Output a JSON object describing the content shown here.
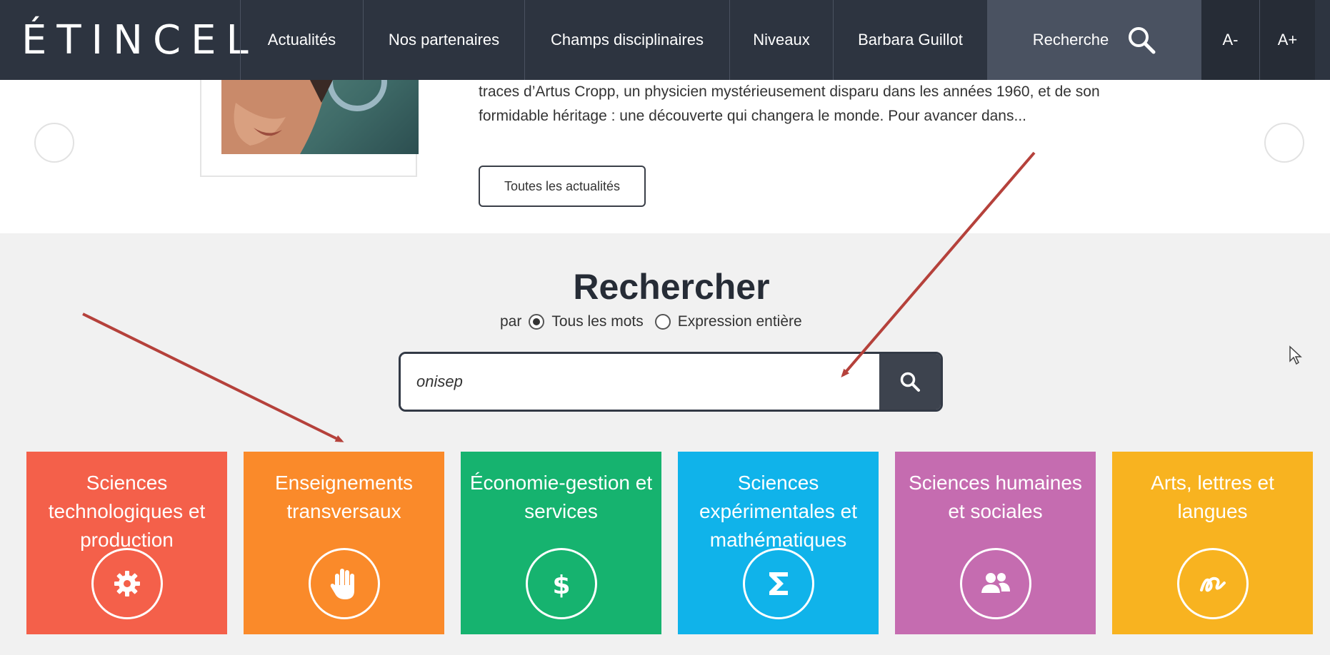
{
  "nav": {
    "logo": "ÉTINCEL",
    "items": [
      {
        "label": "Actualités"
      },
      {
        "label": "Nos partenaires"
      },
      {
        "label": "Champs disciplinaires"
      },
      {
        "label": "Niveaux"
      },
      {
        "label": "Barbara Guillot"
      }
    ],
    "search_label": "Recherche",
    "font_decrease": "A-",
    "font_increase": "A+"
  },
  "news": {
    "excerpt": "traces d’Artus Cropp, un physicien mystérieusement disparu dans les années 1960, et de son formidable héritage : une découverte qui changera le monde. Pour avancer dans...",
    "all_news_button": "Toutes les actualités"
  },
  "search": {
    "title": "Rechercher",
    "by_label": "par",
    "mode_all_words": "Tous les mots",
    "mode_exact": "Expression entière",
    "selected_mode": "Tous les mots",
    "query": "onisep"
  },
  "tiles": [
    {
      "label": "Sciences technologiques et production",
      "icon": "gear-icon",
      "color": "#f4604a"
    },
    {
      "label": "Enseignements transversaux",
      "icon": "hand-icon",
      "color": "#fa8a2a"
    },
    {
      "label": "Économie-gestion et services",
      "icon": "dollar-icon",
      "color": "#16b36f"
    },
    {
      "label": "Sciences expérimentales et mathématiques",
      "icon": "sigma-icon",
      "color": "#10b3ea"
    },
    {
      "label": "Sciences humaines et sociales",
      "icon": "people-icon",
      "color": "#c56cb0"
    },
    {
      "label": "Arts, lettres et langues",
      "icon": "squiggle-icon",
      "color": "#f8b320"
    }
  ],
  "colors": {
    "nav_bg": "#2d3440",
    "nav_search_bg": "#4a5261",
    "section_bg": "#f1f1f1",
    "arrow": "#b5413b"
  }
}
